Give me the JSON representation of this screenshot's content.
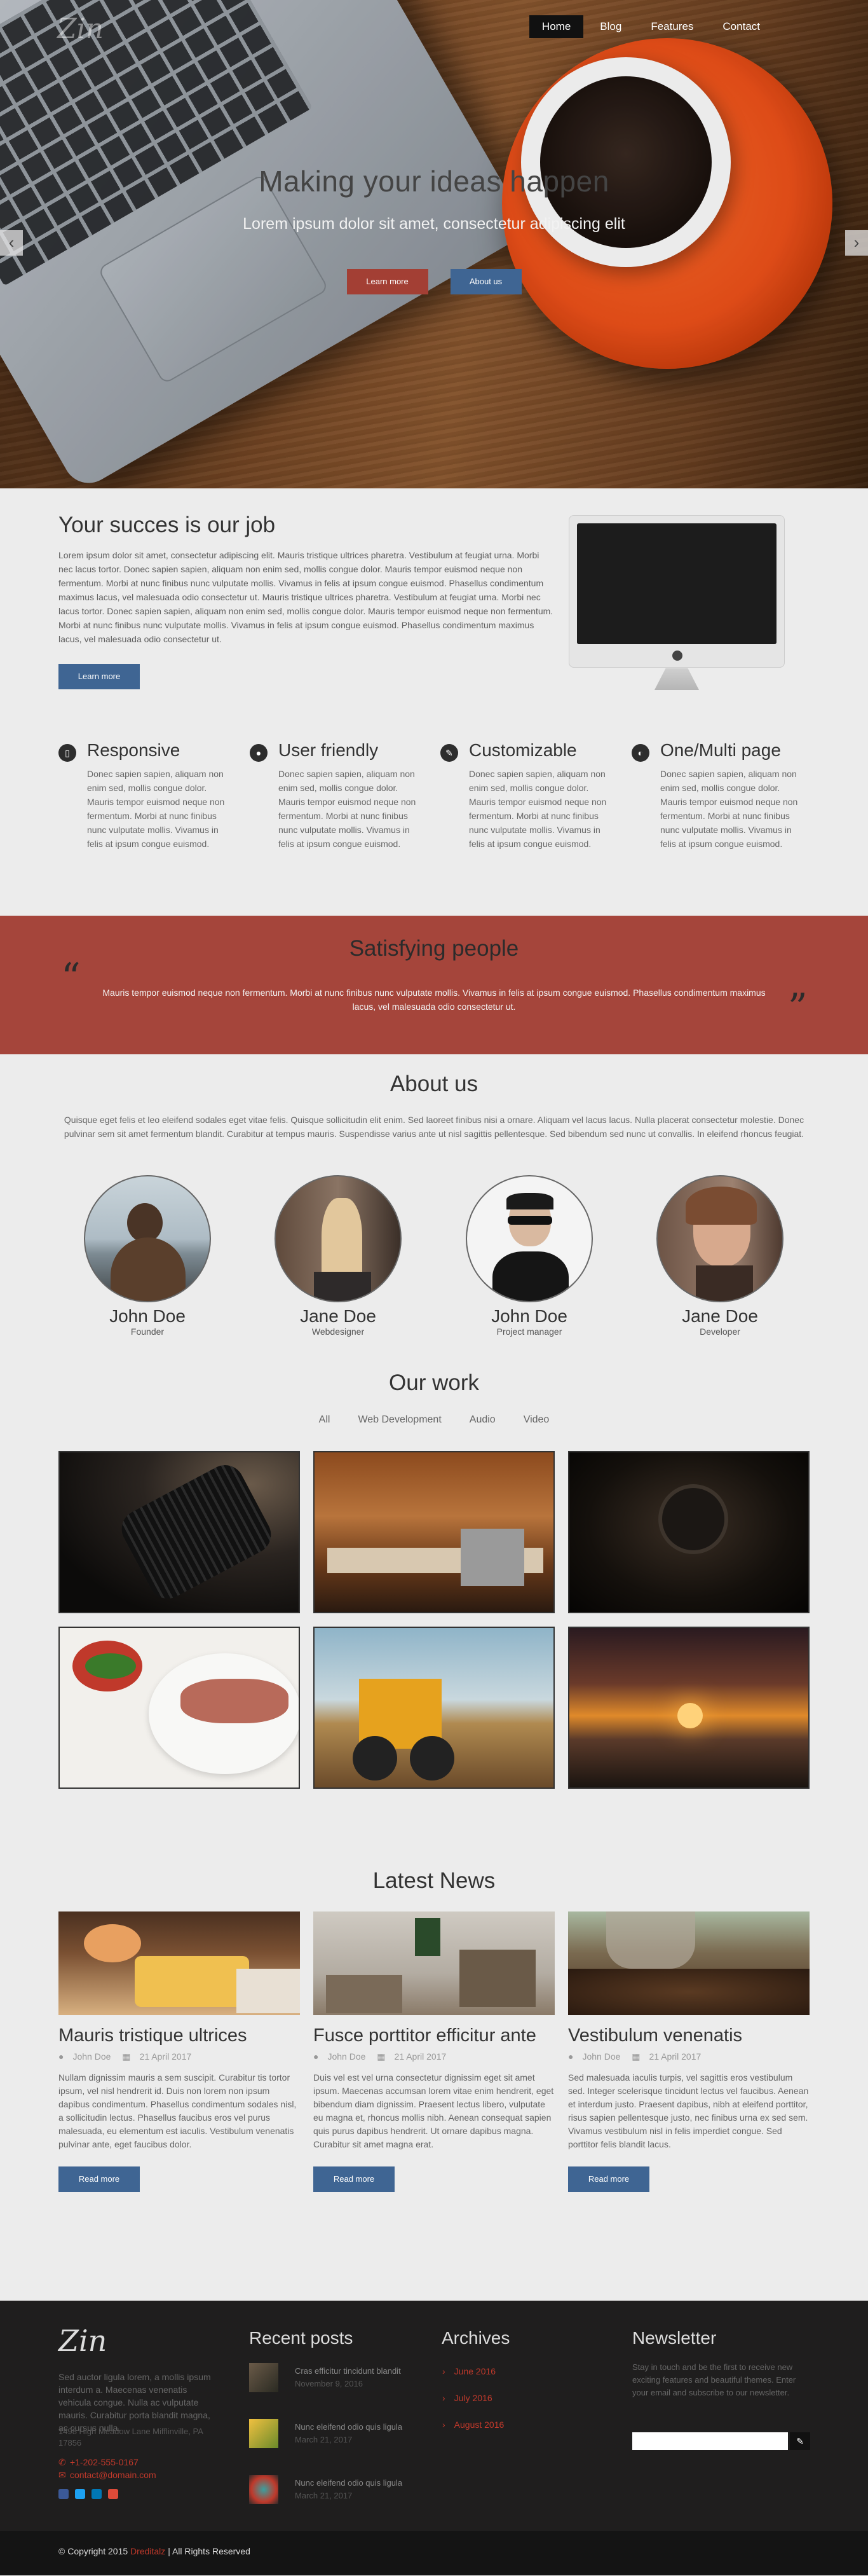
{
  "nav": {
    "logo": "Zin",
    "items": [
      {
        "label": "Home",
        "active": true
      },
      {
        "label": "Blog",
        "active": false
      },
      {
        "label": "Features",
        "active": false
      },
      {
        "label": "Contact",
        "active": false
      }
    ]
  },
  "hero": {
    "title": "Making your ideas happen",
    "subtitle": "Lorem ipsum dolor sit amet, consectetur adipiscing elit",
    "btn_primary": "Learn more",
    "btn_secondary": "About us",
    "prev_icon": "chevron-left",
    "next_icon": "chevron-right",
    "prev_glyph": "‹",
    "next_glyph": "›"
  },
  "success": {
    "title": "Your succes is our job",
    "text": "Lorem ipsum dolor sit amet, consectetur adipiscing elit. Mauris tristique ultrices pharetra. Vestibulum at feugiat urna. Morbi nec lacus tortor. Donec sapien sapien, aliquam non enim sed, mollis congue dolor. Mauris tempor euismod neque non fermentum. Morbi at nunc finibus nunc vulputate mollis. Vivamus in felis at ipsum congue euismod. Phasellus condimentum maximus lacus, vel malesuada odio consectetur ut. Mauris tristique ultrices pharetra. Vestibulum at feugiat urna. Morbi nec lacus tortor. Donec sapien sapien, aliquam non enim sed, mollis congue dolor. Mauris tempor euismod neque non fermentum. Morbi at nunc finibus nunc vulputate mollis. Vivamus in felis at ipsum congue euismod. Phasellus condimentum maximus lacus, vel malesuada odio consectetur ut.",
    "button": "Learn more"
  },
  "features": [
    {
      "icon": "mobile-icon",
      "title": "Responsive",
      "text": "Donec sapien sapien, aliquam non enim sed, mollis congue dolor. Mauris tempor euismod neque non fermentum. Morbi at nunc finibus nunc vulputate mollis. Vivamus in felis at ipsum congue euismod.",
      "glyph": "▯"
    },
    {
      "icon": "user-icon",
      "title": "User friendly",
      "text": "Donec sapien sapien, aliquam non enim sed, mollis congue dolor. Mauris tempor euismod neque non fermentum. Morbi at nunc finibus nunc vulputate mollis. Vivamus in felis at ipsum congue euismod.",
      "glyph": "●"
    },
    {
      "icon": "pencil-icon",
      "title": "Customizable",
      "text": "Donec sapien sapien, aliquam non enim sed, mollis congue dolor. Mauris tempor euismod neque non fermentum. Morbi at nunc finibus nunc vulputate mollis. Vivamus in felis at ipsum congue euismod.",
      "glyph": "✎"
    },
    {
      "icon": "page-icon",
      "title": "One/Multi page",
      "text": "Donec sapien sapien, aliquam non enim sed, mollis congue dolor. Mauris tempor euismod neque non fermentum. Morbi at nunc finibus nunc vulputate mollis. Vivamus in felis at ipsum congue euismod.",
      "glyph": "◐"
    }
  ],
  "testimonial": {
    "title": "Satisfying people",
    "text": "Mauris tempor euismod neque non fermentum. Morbi at nunc finibus nunc vulputate mollis. Vivamus in felis at ipsum congue euismod. Phasellus condimentum maximus lacus, vel malesuada odio consectetur ut.",
    "open_quote": "“",
    "close_quote": "”"
  },
  "about": {
    "title": "About us",
    "text": "Quisque eget felis et leo eleifend sodales eget vitae felis. Quisque sollicitudin elit enim. Sed laoreet finibus nisi a ornare. Aliquam vel lacus lacus. Nulla placerat consectetur molestie. Donec pulvinar sem sit amet fermentum blandit. Curabitur at tempus mauris. Suspendisse varius ante ut nisl sagittis pellentesque. Sed bibendum sed nunc ut convallis. In eleifend rhoncus feugiat.",
    "team": [
      {
        "name": "John Doe",
        "role": "Founder"
      },
      {
        "name": "Jane Doe",
        "role": "Webdesigner"
      },
      {
        "name": "John Doe",
        "role": "Project manager"
      },
      {
        "name": "Jane Doe",
        "role": "Developer"
      }
    ]
  },
  "work": {
    "title": "Our work",
    "filters": [
      "All",
      "Web Development",
      "Audio",
      "Video"
    ]
  },
  "news": {
    "title": "Latest News",
    "posts": [
      {
        "title": "Mauris tristique ultrices",
        "author": "John Doe",
        "date": "21 April 2017",
        "text": "Nullam dignissim mauris a sem suscipit. Curabitur tis tortor ipsum, vel nisl hendrerit id. Duis non lorem non ipsum dapibus condimentum. Phasellus condimentum sodales nisl, a sollicitudin lectus. Phasellus faucibus eros vel purus malesuada, eu elementum est iaculis. Vestibulum venenatis pulvinar ante, eget faucibus dolor.",
        "button": "Read more"
      },
      {
        "title": "Fusce porttitor efficitur ante",
        "author": "John Doe",
        "date": "21 April 2017",
        "text": "Duis vel est vel urna consectetur dignissim eget sit amet ipsum. Maecenas accumsan lorem vitae enim hendrerit, eget bibendum diam dignissim. Praesent lectus libero, vulputate eu magna et, rhoncus mollis nibh. Aenean consequat sapien quis purus dapibus hendrerit. Ut ornare dapibus magna. Curabitur sit amet magna erat.",
        "button": "Read more"
      },
      {
        "title": "Vestibulum venenatis",
        "author": "John Doe",
        "date": "21 April 2017",
        "text": "Sed malesuada iaculis turpis, vel sagittis eros vestibulum sed. Integer scelerisque tincidunt lectus vel faucibus. Aenean et interdum justo. Praesent dapibus, nibh at eleifend porttitor, risus sapien pellentesque justo, nec finibus urna ex sed sem. Vivamus vestibulum nisl in felis imperdiet congue. Sed porttitor felis blandit lacus.",
        "button": "Read more"
      }
    ]
  },
  "footer": {
    "logo": "Zin",
    "description": "Sed auctor ligula lorem, a mollis ipsum interdum a. Maecenas venenatis vehicula congue. Nulla ac vulputate mauris. Curabitur porta blandit magna, ac cursus nulla.",
    "address": "1498 High Meadow Lane Mifflinville, PA 17856",
    "phone": "+1-202-555-0167",
    "email": "contact@domain.com",
    "phone_glyph": "✆",
    "email_glyph": "✉",
    "recent_title": "Recent posts",
    "recent": [
      {
        "title": "Cras efficitur tincidunt blandit",
        "date": "November 9, 2016"
      },
      {
        "title": "Nunc eleifend odio quis ligula",
        "date": "March 21, 2017"
      },
      {
        "title": "Nunc eleifend odio quis ligula",
        "date": "March 21, 2017"
      }
    ],
    "archives_title": "Archives",
    "archives": [
      "June 2016",
      "July 2016",
      "August 2016"
    ],
    "newsletter_title": "Newsletter",
    "newsletter_text": "Stay in touch and be the first to receive new exciting features and beautiful themes. Enter your email and subscribe to our newsletter.",
    "newsletter_placeholder": "",
    "newsletter_button_glyph": "✎",
    "copyright_prefix": "© Copyright 2015",
    "copyright_brand": "Dreditalz",
    "copyright_suffix": "| All Rights Reserved",
    "social_colors": [
      "#3b5998",
      "#1da1f2",
      "#0077b5",
      "#dd4b39"
    ]
  },
  "colors": {
    "accent_red": "#a5453b",
    "accent_blue": "#3f6593",
    "footer_bg": "#1f1e1e"
  }
}
